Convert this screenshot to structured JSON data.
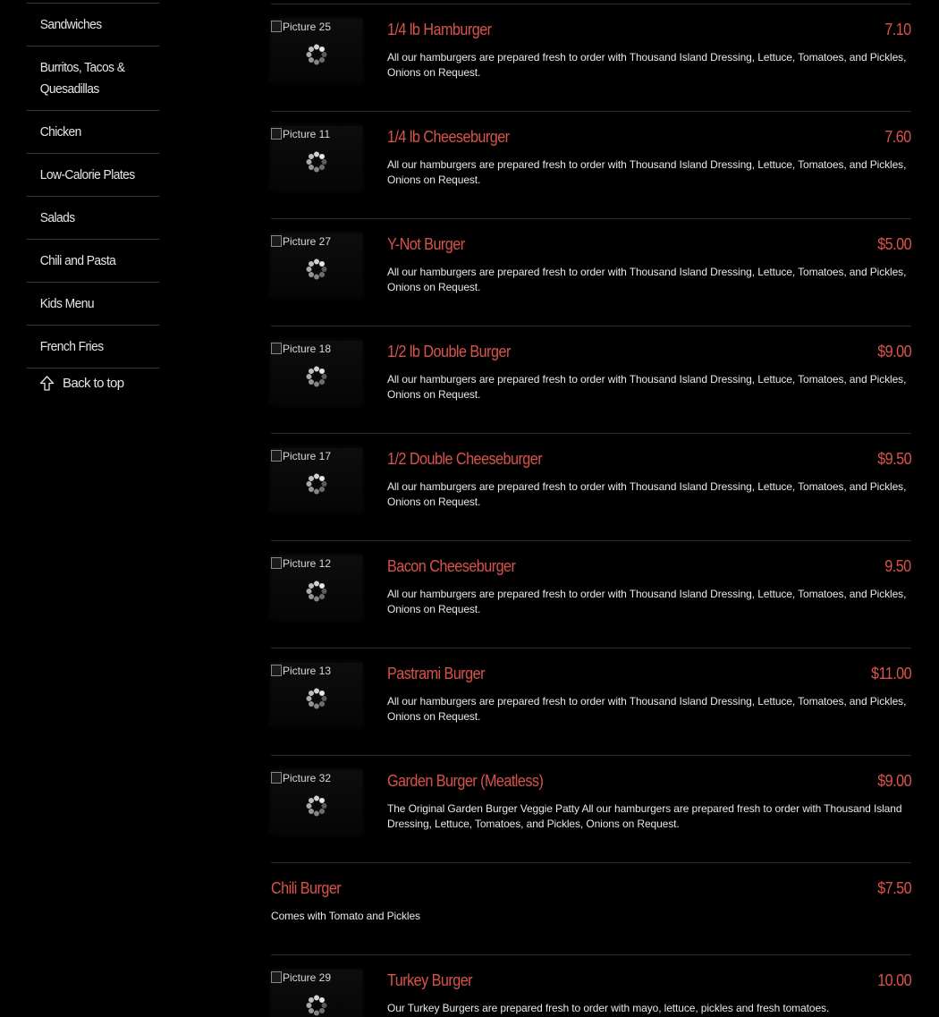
{
  "sidebar": {
    "items": [
      {
        "label": "Sandwiches"
      },
      {
        "label": "Burritos, Tacos & Quesadillas"
      },
      {
        "label": "Chicken"
      },
      {
        "label": "Low-Calorie Plates"
      },
      {
        "label": "Salads"
      },
      {
        "label": "Chili and Pasta"
      },
      {
        "label": "Kids Menu"
      },
      {
        "label": "French Fries"
      }
    ],
    "back_to_top": "Back to top",
    "back_icon": "up-arrow-icon"
  },
  "colors": {
    "background": "#000000",
    "accent": "#d9534a",
    "text": "#e8e8e8"
  },
  "menu": [
    {
      "pic": "Picture 25",
      "name": "1/4 lb Hamburger",
      "price": "7.10",
      "desc": "All our hamburgers are prepared fresh to order with Thousand Island Dressing, Lettuce, Tomatoes, and Pickles, Onions on Request."
    },
    {
      "pic": "Picture 11",
      "name": "1/4 lb Cheeseburger",
      "price": "7.60",
      "desc": "All our hamburgers are prepared fresh to order with Thousand Island Dressing, Lettuce, Tomatoes, and Pickles, Onions on Request."
    },
    {
      "pic": "Picture 27",
      "name": "Y-Not Burger",
      "price": "$5.00",
      "desc": "All our hamburgers are prepared fresh to order with Thousand Island Dressing, Lettuce, Tomatoes, and Pickles, Onions on Request."
    },
    {
      "pic": "Picture 18",
      "name": "1/2 lb Double Burger",
      "price": "$9.00",
      "desc": "All our hamburgers are prepared fresh to order with Thousand Island Dressing, Lettuce, Tomatoes, and Pickles, Onions on Request."
    },
    {
      "pic": "Picture 17",
      "name": "1/2 Double Cheeseburger",
      "price": "$9.50",
      "desc": "All our hamburgers are prepared fresh to order with Thousand Island Dressing, Lettuce, Tomatoes, and Pickles, Onions on Request."
    },
    {
      "pic": "Picture 12",
      "name": "Bacon Cheeseburger",
      "price": "9.50",
      "desc": "All our hamburgers are prepared fresh to order with Thousand Island Dressing, Lettuce, Tomatoes, and Pickles, Onions on Request."
    },
    {
      "pic": "Picture 13",
      "name": "Pastrami Burger",
      "price": "$11.00",
      "desc": "All our hamburgers are prepared fresh to order with Thousand Island Dressing, Lettuce, Tomatoes, and Pickles, Onions on Request."
    },
    {
      "pic": "Picture 32",
      "name": "Garden Burger (Meatless)",
      "price": "$9.00",
      "desc": "The Original Garden Burger Veggie Patty All our hamburgers are prepared fresh to order with Thousand Island Dressing, Lettuce, Tomatoes, and Pickles, Onions on Request."
    },
    {
      "pic": "",
      "name": "Chili Burger",
      "price": "$7.50",
      "desc": "Comes with Tomato and Pickles"
    },
    {
      "pic": "Picture 29",
      "name": "Turkey Burger",
      "price": "10.00",
      "desc": "Our Turkey Burgers are prepared fresh to order with mayo, lettuce, pickles and fresh tomatoes."
    }
  ]
}
